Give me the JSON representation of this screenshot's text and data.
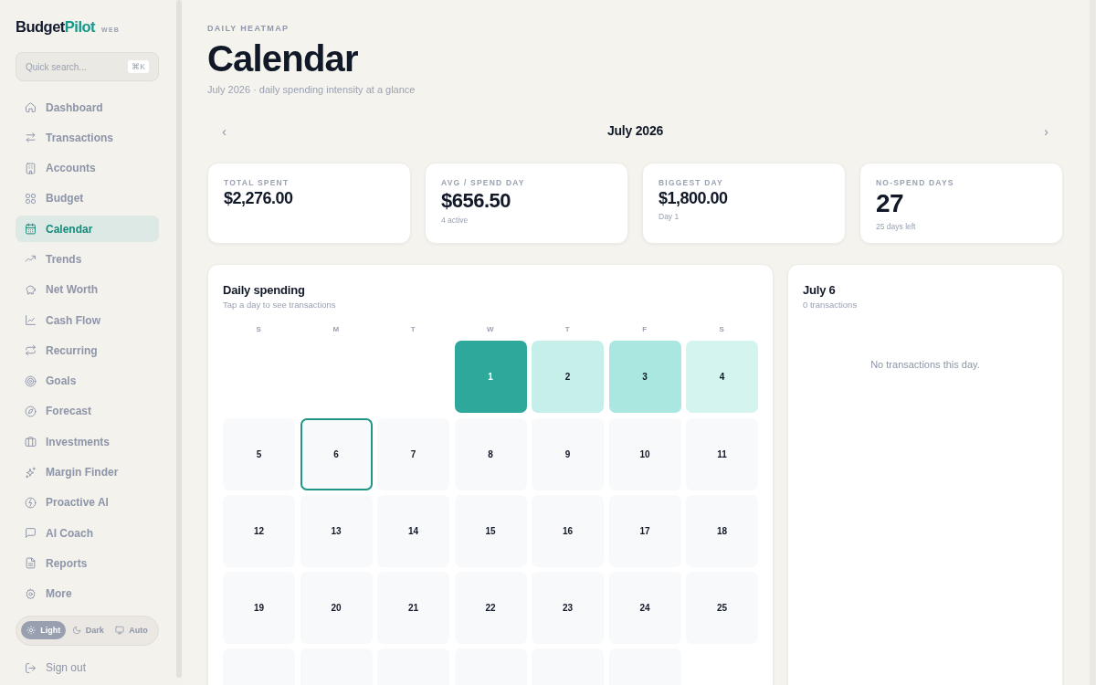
{
  "sidebar": {
    "logo": {
      "parts": [
        "Budget",
        "Pilot"
      ],
      "tag": "WEB"
    },
    "search": {
      "placeholder": "Quick search...",
      "shortcut": "⌘K"
    },
    "nav": [
      {
        "label": "Dashboard",
        "selected": false
      },
      {
        "label": "Transactions",
        "selected": false
      },
      {
        "label": "Accounts",
        "selected": false
      },
      {
        "label": "Budget",
        "selected": false
      },
      {
        "label": "Calendar",
        "selected": true
      },
      {
        "label": "Trends",
        "selected": false
      },
      {
        "label": "Net Worth",
        "selected": false
      },
      {
        "label": "Cash Flow",
        "selected": false
      },
      {
        "label": "Recurring",
        "selected": false
      },
      {
        "label": "Goals",
        "selected": false
      },
      {
        "label": "Forecast",
        "selected": false
      },
      {
        "label": "Investments",
        "selected": false
      },
      {
        "label": "Margin Finder",
        "selected": false
      },
      {
        "label": "Proactive AI",
        "selected": false
      },
      {
        "label": "AI Coach",
        "selected": false
      },
      {
        "label": "Reports",
        "selected": false
      },
      {
        "label": "More",
        "selected": false
      }
    ],
    "theme": [
      {
        "label": "Light",
        "selected": true
      },
      {
        "label": "Dark",
        "selected": false
      },
      {
        "label": "Auto",
        "selected": false
      }
    ],
    "sign_out": "Sign out"
  },
  "header": {
    "eyebrow": "DAILY HEATMAP",
    "title": "Calendar",
    "subtitle": "July 2026 · daily spending intensity at a glance"
  },
  "month_nav": {
    "prev": "‹",
    "month": "July 2026",
    "next": "›"
  },
  "stats": [
    {
      "label": "TOTAL SPENT",
      "value": "$2,276.00"
    },
    {
      "label": "AVG / SPEND DAY",
      "value": "$656.50",
      "note": "4 active"
    },
    {
      "label": "BIGGEST DAY",
      "value": "$1,800.00",
      "note": "Day 1"
    },
    {
      "label": "NO-SPEND DAYS",
      "value": "27",
      "note": "25 days left"
    }
  ],
  "calendar": {
    "title": "Daily spending",
    "subtitle": "Tap a day to see transactions",
    "weekdays": [
      "S",
      "M",
      "T",
      "W",
      "T",
      "F",
      "S"
    ],
    "days": [
      {
        "kind": "blank"
      },
      {
        "kind": "blank"
      },
      {
        "kind": "blank"
      },
      {
        "kind": "day",
        "day": "1",
        "color": "#2ea89a",
        "selected": false
      },
      {
        "kind": "day",
        "day": "2",
        "color": "#c6efe9",
        "selected": false
      },
      {
        "kind": "day",
        "day": "3",
        "color": "#a9e7e0",
        "selected": false
      },
      {
        "kind": "day",
        "day": "4",
        "color": "#d3f4ef",
        "selected": false
      },
      {
        "kind": "day",
        "day": "5",
        "color": "#f7f9fa",
        "selected": false
      },
      {
        "kind": "day",
        "day": "6",
        "color": "#f7f9fa",
        "selected": true
      },
      {
        "kind": "day",
        "day": "7",
        "color": "#f7f9fa",
        "selected": false
      },
      {
        "kind": "day",
        "day": "8",
        "color": "#f7f9fa",
        "selected": false
      },
      {
        "kind": "day",
        "day": "9",
        "color": "#f7f9fa",
        "selected": false
      },
      {
        "kind": "day",
        "day": "10",
        "color": "#f7f9fa",
        "selected": false
      },
      {
        "kind": "day",
        "day": "11",
        "color": "#f7f9fa",
        "selected": false
      },
      {
        "kind": "day",
        "day": "12",
        "color": "#f7f9fa",
        "selected": false
      },
      {
        "kind": "day",
        "day": "13",
        "color": "#f7f9fa",
        "selected": false
      },
      {
        "kind": "day",
        "day": "14",
        "color": "#f7f9fa",
        "selected": false
      },
      {
        "kind": "day",
        "day": "15",
        "color": "#f7f9fa",
        "selected": false
      },
      {
        "kind": "day",
        "day": "16",
        "color": "#f7f9fa",
        "selected": false
      },
      {
        "kind": "day",
        "day": "17",
        "color": "#f7f9fa",
        "selected": false
      },
      {
        "kind": "day",
        "day": "18",
        "color": "#f7f9fa",
        "selected": false
      },
      {
        "kind": "day",
        "day": "19",
        "color": "#f7f9fa",
        "selected": false
      },
      {
        "kind": "day",
        "day": "20",
        "color": "#f7f9fa",
        "selected": false
      },
      {
        "kind": "day",
        "day": "21",
        "color": "#f7f9fa",
        "selected": false
      },
      {
        "kind": "day",
        "day": "22",
        "color": "#f7f9fa",
        "selected": false
      },
      {
        "kind": "day",
        "day": "23",
        "color": "#f7f9fa",
        "selected": false
      },
      {
        "kind": "day",
        "day": "24",
        "color": "#f7f9fa",
        "selected": false
      },
      {
        "kind": "day",
        "day": "25",
        "color": "#f7f9fa",
        "selected": false
      },
      {
        "kind": "cut",
        "color": "#f7f9fa"
      },
      {
        "kind": "cut",
        "color": "#f7f9fa"
      },
      {
        "kind": "cut",
        "color": "#f7f9fa"
      },
      {
        "kind": "cut",
        "color": "#f7f9fa"
      },
      {
        "kind": "cut",
        "color": "#f7f9fa"
      },
      {
        "kind": "cut",
        "color": "#f7f9fa"
      }
    ]
  },
  "detail": {
    "title": "July 6",
    "count": "0 transactions",
    "empty_message": "No transactions this day."
  }
}
